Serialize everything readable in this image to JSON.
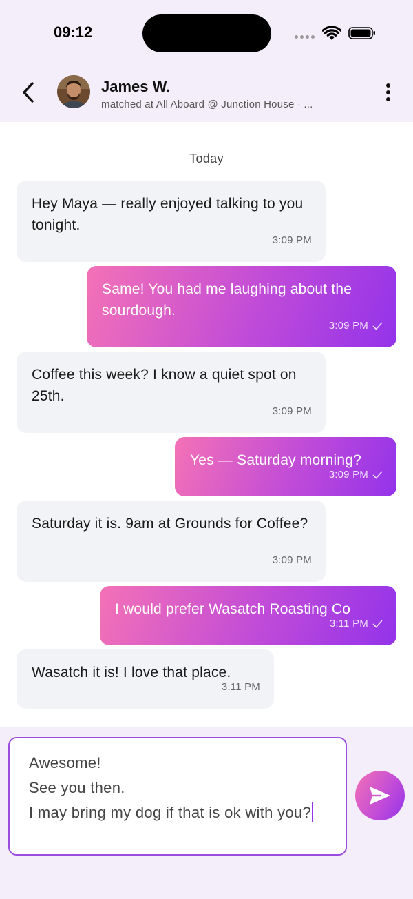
{
  "status": {
    "time": "09:12",
    "signal_icon": "cellular-dots-icon",
    "wifi_icon": "wifi-icon",
    "battery_icon": "battery-icon"
  },
  "header": {
    "back_icon": "chevron-left-icon",
    "contact_name": "James W.",
    "contact_subtitle": "matched at All Aboard @ Junction House · ...",
    "more_icon": "vertical-ellipsis-icon"
  },
  "conversation": {
    "date_divider": "Today",
    "messages": [
      {
        "direction": "in",
        "text": "Hey Maya — really enjoyed talking to you tonight.",
        "time": "3:09 PM",
        "read": false
      },
      {
        "direction": "out",
        "text": "Same! You had me laughing about the sourdough.",
        "time": "3:09 PM",
        "read": true
      },
      {
        "direction": "in",
        "text": "Coffee this week? I know a quiet spot on 25th.",
        "time": "3:09 PM",
        "read": false
      },
      {
        "direction": "out",
        "text": "Yes — Saturday morning?",
        "time": "3:09 PM",
        "read": true
      },
      {
        "direction": "in",
        "text": "Saturday it is. 9am at Grounds for Coffee?",
        "time": "3:09 PM",
        "read": false
      },
      {
        "direction": "out",
        "text": "I would prefer Wasatch Roasting Co",
        "time": "3:11 PM",
        "read": true
      },
      {
        "direction": "in",
        "text": "Wasatch it is! I love that place.",
        "time": "3:11 PM",
        "read": false
      }
    ]
  },
  "composer": {
    "value": "Awesome!\nSee you then.\nI may bring my dog if that is ok with you?",
    "send_icon": "send-paper-plane-icon"
  },
  "colors": {
    "header_bg": "#f4eefb",
    "incoming_bubble": "#f1f3f6",
    "outgoing_gradient_start": "#f472b6",
    "outgoing_gradient_end": "#9333ea",
    "input_border": "#9b4de0"
  }
}
